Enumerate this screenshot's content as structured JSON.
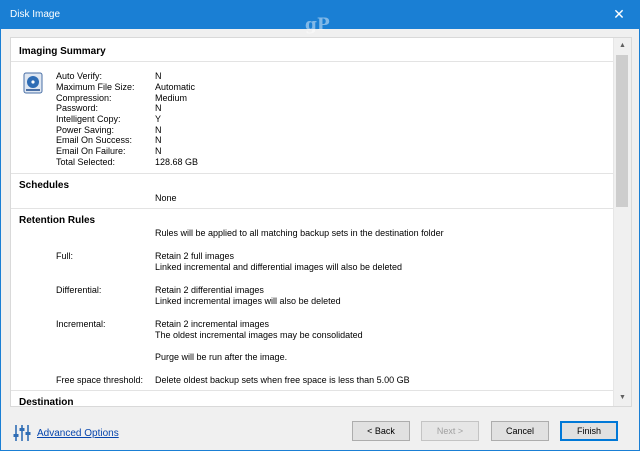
{
  "window": {
    "title": "Disk Image",
    "watermark": "gP",
    "close_glyph": "✕"
  },
  "summary": {
    "title": "Imaging Summary",
    "rows": [
      {
        "label": "Auto Verify:",
        "value": "N"
      },
      {
        "label": "Maximum File Size:",
        "value": "Automatic"
      },
      {
        "label": "Compression:",
        "value": "Medium"
      },
      {
        "label": "Password:",
        "value": "N"
      },
      {
        "label": "Intelligent Copy:",
        "value": "Y"
      },
      {
        "label": "Power Saving:",
        "value": "N"
      },
      {
        "label": "Email On Success:",
        "value": "N"
      },
      {
        "label": "Email On Failure:",
        "value": "N"
      },
      {
        "label": "Total Selected:",
        "value": "128.68 GB"
      }
    ]
  },
  "schedules": {
    "title": "Schedules",
    "value": "None"
  },
  "retention": {
    "title": "Retention Rules",
    "intro": "Rules will be applied to all matching backup sets in the destination folder",
    "full": {
      "label": "Full:",
      "line1": "Retain 2 full images",
      "line2": "Linked incremental and differential images will also be deleted"
    },
    "differential": {
      "label": "Differential:",
      "line1": "Retain 2 differential images",
      "line2": "Linked incremental images will also be deleted"
    },
    "incremental": {
      "label": "Incremental:",
      "line1": "Retain 2 incremental images",
      "line2": "The oldest incremental images may be consolidated"
    },
    "purge": "Purge will be run after the image.",
    "free_space": {
      "label": "Free space threshold:",
      "value": "Delete oldest backup sets when free space is less than 5.00 GB"
    }
  },
  "destination": {
    "title": "Destination"
  },
  "footer": {
    "advanced_options": "Advanced Options",
    "back": "< Back",
    "next": "Next >",
    "cancel": "Cancel",
    "finish": "Finish"
  },
  "colors": {
    "titlebar": "#1a7fd4",
    "link": "#0645ad",
    "primary_border": "#0078d7"
  },
  "icons": [
    "disk-icon",
    "advanced-options-icon",
    "close-icon",
    "scroll-up-icon",
    "scroll-down-icon"
  ]
}
